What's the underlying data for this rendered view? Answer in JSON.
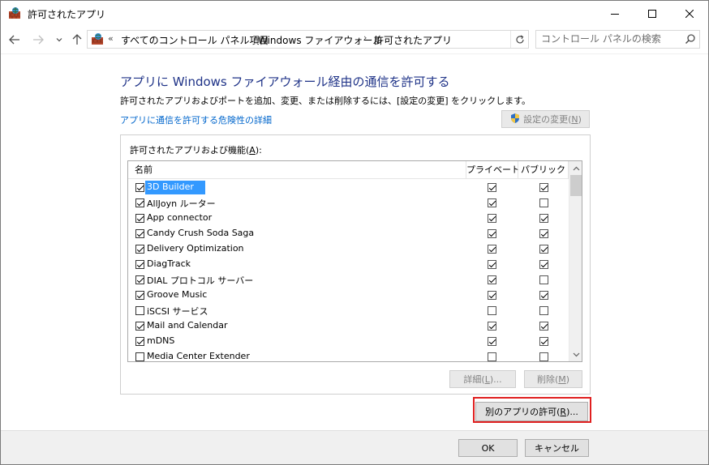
{
  "window": {
    "title": "許可されたアプリ",
    "icon": "firewall-icon"
  },
  "address_bar": {
    "overflow_chevron": "«",
    "crumbs": [
      "すべてのコントロール パネル項目",
      "Windows ファイアウォール",
      "許可されたアプリ"
    ],
    "separator": "›"
  },
  "search": {
    "placeholder": "コントロール パネルの検索"
  },
  "content": {
    "heading": "アプリに Windows ファイアウォール経由の通信を許可する",
    "description": "許可されたアプリおよびポートを追加、変更、または削除するには、[設定の変更] をクリックします。",
    "risk_link": "アプリに通信を許可する危険性の詳細",
    "change_settings": {
      "text": "設定の変更(",
      "key": "N",
      "tail": ")"
    }
  },
  "group": {
    "label_text": "許可されたアプリおよび機能(",
    "label_key": "A",
    "label_tail": "):",
    "columns": {
      "name": "名前",
      "private": "プライベート",
      "public": "パブリック"
    },
    "rows": [
      {
        "name": "3D Builder",
        "enabled": true,
        "private": true,
        "public": true,
        "selected": true
      },
      {
        "name": "AllJoyn ルーター",
        "enabled": true,
        "private": true,
        "public": false
      },
      {
        "name": "App connector",
        "enabled": true,
        "private": true,
        "public": true
      },
      {
        "name": "Candy Crush Soda Saga",
        "enabled": true,
        "private": true,
        "public": true
      },
      {
        "name": "Delivery Optimization",
        "enabled": true,
        "private": true,
        "public": true
      },
      {
        "name": "DiagTrack",
        "enabled": true,
        "private": true,
        "public": true
      },
      {
        "name": "DIAL プロトコル サーバー",
        "enabled": true,
        "private": true,
        "public": false
      },
      {
        "name": "Groove Music",
        "enabled": true,
        "private": true,
        "public": true
      },
      {
        "name": "iSCSI サービス",
        "enabled": false,
        "private": false,
        "public": false
      },
      {
        "name": "Mail and Calendar",
        "enabled": true,
        "private": true,
        "public": true
      },
      {
        "name": "mDNS",
        "enabled": true,
        "private": true,
        "public": true
      },
      {
        "name": "Media Center Extender",
        "enabled": false,
        "private": false,
        "public": false
      }
    ],
    "details_btn": {
      "text": "詳細(",
      "key": "L",
      "tail": ")..."
    },
    "remove_btn": {
      "text": "削除(",
      "key": "M",
      "tail": ")"
    }
  },
  "allow_another": {
    "text": "別のアプリの許可(",
    "key": "R",
    "tail": ")..."
  },
  "footer": {
    "ok": "OK",
    "cancel": "キャンセル"
  }
}
